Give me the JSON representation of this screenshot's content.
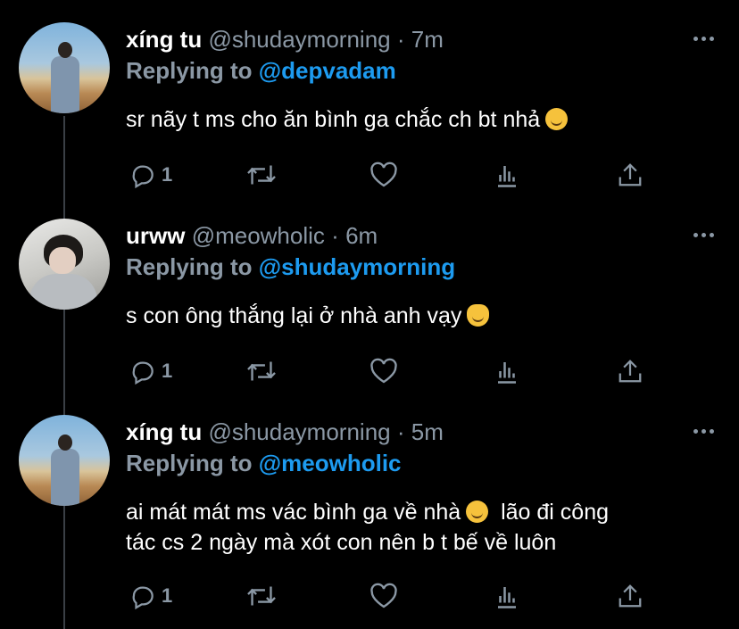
{
  "tweets": [
    {
      "name": "xíng tu",
      "handle": "@shudaymorning",
      "separator": "·",
      "time": "7m",
      "replying_label": "Replying to",
      "replying_to": "@depvadam",
      "text": "sr nãy t ms cho ăn bình ga chắc ch bt nhả",
      "text_line2": "",
      "emoji": "yum-face-emoji",
      "reply_count": "1",
      "avatar": "desert-photo-avatar"
    },
    {
      "name": "urww",
      "handle": "@meowholic",
      "separator": "·",
      "time": "6m",
      "replying_label": "Replying to",
      "replying_to": "@shudaymorning",
      "text": "s con ông thắng lại ở nhà anh vạy",
      "text_line2": "",
      "emoji": "kissing-cat-emoji",
      "reply_count": "1",
      "avatar": "portrait-photo-avatar"
    },
    {
      "name": "xíng tu",
      "handle": "@shudaymorning",
      "separator": "·",
      "time": "5m",
      "replying_label": "Replying to",
      "replying_to": "@meowholic",
      "text": "ai mát mát ms vác bình ga về nhà",
      "text_after_emoji": "lão đi công",
      "text_line2": "tác cs 2 ngày mà xót con nên b t bế về luôn",
      "emoji": "sweat-smile-emoji",
      "reply_count": "1",
      "avatar": "desert-photo-avatar"
    }
  ],
  "colors": {
    "background": "#000000",
    "secondary_text": "#8b98a5",
    "link": "#1d9bf0",
    "thread_line": "#3a3f45"
  }
}
